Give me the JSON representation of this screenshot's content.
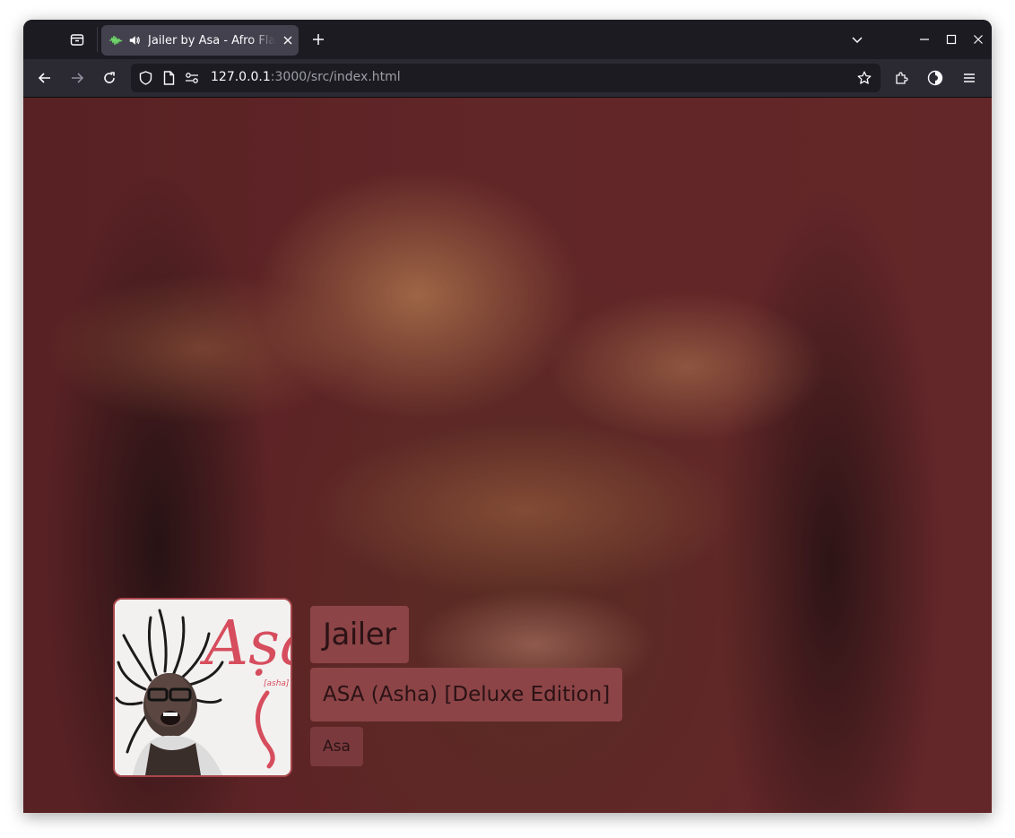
{
  "browser": {
    "tab": {
      "title": "Jailer by Asa - Afro Flava",
      "audio_playing": true
    },
    "url": {
      "host": "127.0.0.1",
      "rest": ":3000/src/index.html"
    }
  },
  "player": {
    "track_title": "Jailer",
    "album": "ASA (Asha) [Deluxe Edition]",
    "artist": "Asa",
    "cover_text": {
      "logo": "Aṣa",
      "sub": "[asha]"
    }
  },
  "colors": {
    "accent": "#8c4446",
    "accent_border": "#a8474c",
    "text_dark": "#2b1215"
  }
}
